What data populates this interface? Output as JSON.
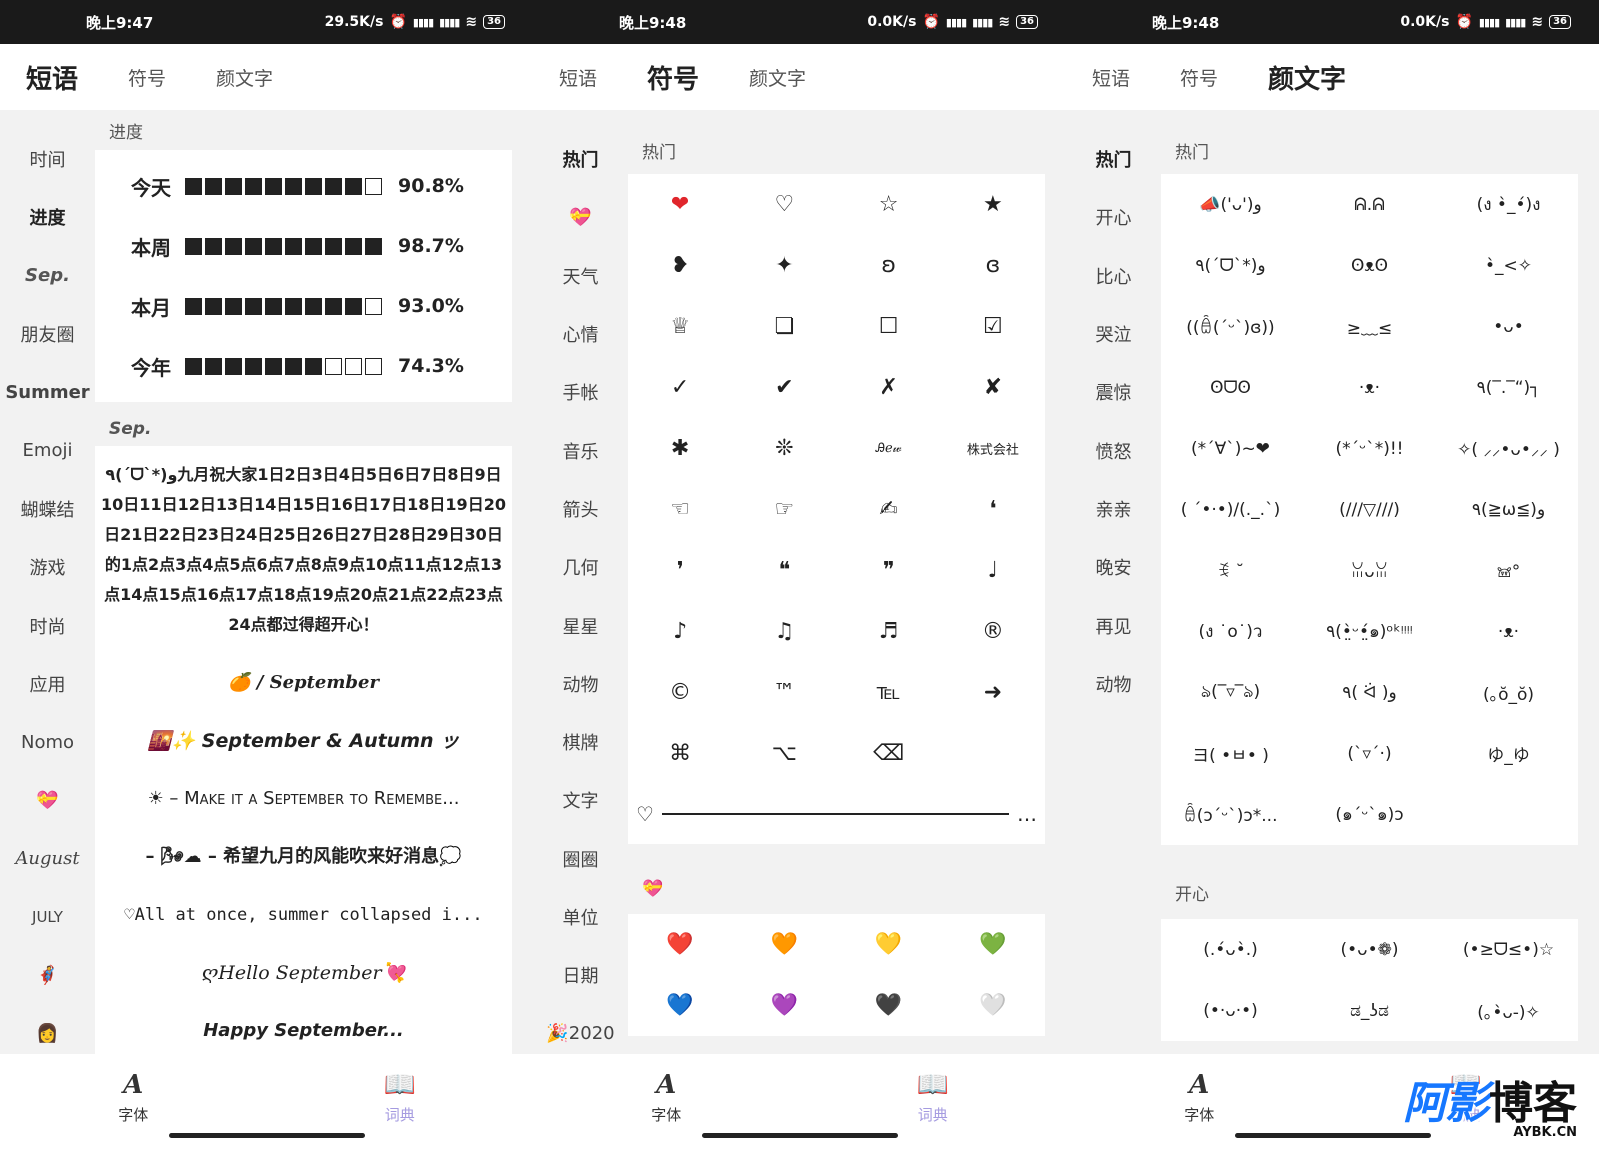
{
  "screens": [
    {
      "status": {
        "time": "晚上9:47",
        "net": "29.5K/s",
        "battery": "36"
      },
      "tabs": [
        "短语",
        "符号",
        "颜文字"
      ],
      "active_tab": 0,
      "nav": [
        "时间",
        "进度",
        "Sep.",
        "朋友圈",
        "Summer",
        "Emoji",
        "蝴蝶结",
        "游戏",
        "时尚",
        "应用",
        "Nomo",
        "💝",
        "August",
        "JULY",
        "🦸",
        "👩"
      ],
      "section1": "进度",
      "progress": [
        {
          "label": "今天",
          "filled": 9,
          "total": 10,
          "pct": "90.8%"
        },
        {
          "label": "本周",
          "filled": 10,
          "total": 10,
          "pct": "98.7%"
        },
        {
          "label": "本月",
          "filled": 9,
          "total": 10,
          "pct": "93.0%"
        },
        {
          "label": "今年",
          "filled": 7,
          "total": 10,
          "pct": "74.3%"
        }
      ],
      "section2": "Sep.",
      "phrases": [
        "٩(ˊᗜˋ*)و九月祝大家1日2日3日4日5日6日7日8日9日10日11日12日13日14日15日16日17日18日19日20日21日22日23日24日25日26日27日28日29日30日的1点2点3点4点5点6点7点8点9点10点11点12点13点14点15点16点17点18点19点20点21点22点23点24点都过得超开心！",
        "🍊 / September",
        "🌇✨ September & Autumn ッ",
        "☀ – Make it a September to Remembe...",
        "– 🌬☁ – 希望九月的风能吹来好消息💭",
        "♡All at once, summer collapsed i...",
        "ღHello September💘",
        "Happy September..."
      ]
    },
    {
      "status": {
        "time": "晚上9:48",
        "net": "0.0K/s",
        "battery": "36"
      },
      "tabs": [
        "短语",
        "符号",
        "颜文字"
      ],
      "active_tab": 1,
      "nav": [
        "热门",
        "💝",
        "天气",
        "心情",
        "手帐",
        "音乐",
        "箭头",
        "几何",
        "星星",
        "动物",
        "棋牌",
        "文字",
        "圈圈",
        "单位",
        "日期",
        "🎉2020"
      ],
      "section1": "热门",
      "symbols": [
        "❤",
        "♡",
        "☆",
        "★",
        "❥",
        "✦",
        "ʚ",
        "ɞ",
        "♕",
        "❏",
        "☐",
        "☑",
        "✓",
        "✔",
        "✗",
        "✘",
        "✱",
        "❊",
        "Ꭿℯ𝓌",
        "株式会社",
        "☜",
        "☞",
        "✍",
        "❛",
        "❜",
        "❝",
        "❞",
        "♩",
        "♪",
        "♫",
        "♬",
        "®",
        "©",
        "™",
        "℡",
        "➜",
        "⌘",
        "⌥",
        "⌫"
      ],
      "divider_text": "♡",
      "section2": "💝",
      "hearts": [
        "❤️",
        "🧡",
        "💛",
        "💚",
        "💙",
        "💜",
        "🖤",
        "🤍"
      ]
    },
    {
      "status": {
        "time": "晚上9:48",
        "net": "0.0K/s",
        "battery": "36"
      },
      "tabs": [
        "短语",
        "符号",
        "颜文字"
      ],
      "active_tab": 2,
      "nav": [
        "热门",
        "开心",
        "比心",
        "哭泣",
        "震惊",
        "愤怒",
        "亲亲",
        "晚安",
        "再见",
        "动物"
      ],
      "section1": "热门",
      "kaomoji_hot": [
        "📣('ᴗ')و",
        "ᕱ.ᕱ",
        "(ง •̀_•́)ง",
        "٩(ˊᗜˋ*)و",
        "ʘᴥʘ",
        "•̀_<✧",
        "((ꎁ(ˊᵕˋ)ɞ))",
        "≥﹏≤",
        "•ᴗ•",
        "ʘᗜʘ",
        "·ᴥ·",
        "٩(‾.‾“)┐",
        "(*ˊ∀ˋ)~❤",
        "(*ˊᵕˋ*)!!",
        "✧( ⸝⸝•ᴗ•⸝⸝ )",
        "( ´•·•)/(._.`)",
        "(///▽///)",
        "٩(≧ω≦)و",
        "ꉂ ˘",
        "ꈍᴗꈍ",
        "𖠌°",
        "(ง ˙o˙)ว",
        "٩(•̤̀ᵕ•̤́๑)ᵒᵏᵎᵎᵎᵎ",
        "·ᴥ·",
        "ঌ(‾▿‾ঌ)",
        "٩( ᐛ )و",
        "(｡ŏ_ŏ)",
        "ヨ( •ㅂ• )",
        "(ˋ▿ˊ·)",
        "ゆ_ゆ",
        "ꎁ(ɔˊᵕˋ)ɔ*...",
        "(๑ˊᵕˋ๑)ɔ"
      ],
      "section2": "开心",
      "kaomoji_happy": [
        "(.•́ᴗ•̀.)",
        "(•ᴗ•❁)",
        "(•≥ᗜ≤•)☆",
        "(•·ᴗ·•)",
        "ಡ_ʖಡ",
        "(｡•̀ᴗ-)✧"
      ]
    }
  ],
  "bottom": {
    "font_label": "字体",
    "dict_label": "词典"
  },
  "watermark": {
    "main": "阿影",
    "blog": "博客",
    "sub": "AYBK.CN"
  },
  "colors": {
    "accent": "#c9c3f2",
    "dict_active": "#a59be0",
    "watermark_blue": "#1677ff"
  }
}
